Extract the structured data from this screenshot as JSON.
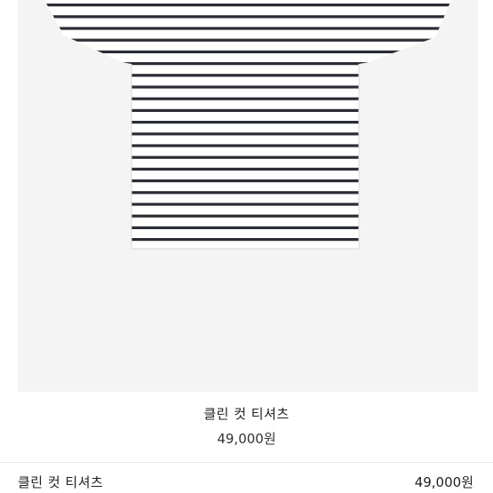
{
  "product": {
    "name": "클린 컷 티셔츠",
    "price": "49,000원"
  },
  "summary": {
    "name": "클린 컷 티셔츠",
    "price": "49,000원"
  },
  "colors": {
    "image_background": "#f4f4f4",
    "stripe": "#2b2d35",
    "shirt_base": "#ffffff"
  }
}
